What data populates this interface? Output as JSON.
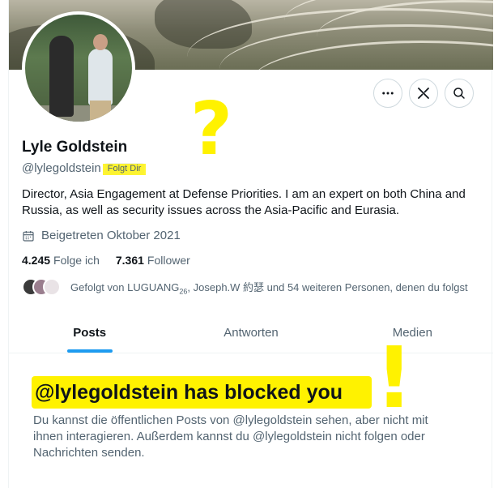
{
  "profile": {
    "name": "Lyle Goldstein",
    "handle": "@lylegoldstein",
    "follows_you_badge": "Folgt Dir",
    "bio": "Director, Asia Engagement at Defense Priorities.  I am an expert on both China and Russia, as well as security issues across the Asia-Pacific and Eurasia.",
    "joined": "Beigetreten Oktober 2021",
    "following_count": "4.245",
    "following_label": "Folge ich",
    "followers_count": "7.361",
    "followers_label": "Follower",
    "followed_by_prefix": "Gefolgt von LUGUANG",
    "followed_by_sub": "26",
    "followed_by_rest": ", Joseph.W 約瑟 und 54 weiteren Personen, denen du folgst"
  },
  "actions": {
    "more_icon": "more-horizontal-icon",
    "grok_icon": "grok-icon",
    "search_icon": "search-icon"
  },
  "tabs": [
    {
      "label": "Posts",
      "active": true
    },
    {
      "label": "Antworten",
      "active": false
    },
    {
      "label": "Medien",
      "active": false
    }
  ],
  "blocked": {
    "title": "@lylegoldstein has blocked you",
    "description": "Du kannst die öffentlichen Posts von @lylegoldstein sehen, aber nicht mit ihnen interagieren. Außerdem kannst du @lylegoldstein nicht folgen oder Nachrichten senden."
  },
  "annotations": {
    "question_mark": "?",
    "exclamation_mark": "!"
  },
  "colors": {
    "accent": "#1d9bf0",
    "highlight": "#fff200",
    "text_primary": "#0f1419",
    "text_secondary": "#536471"
  }
}
